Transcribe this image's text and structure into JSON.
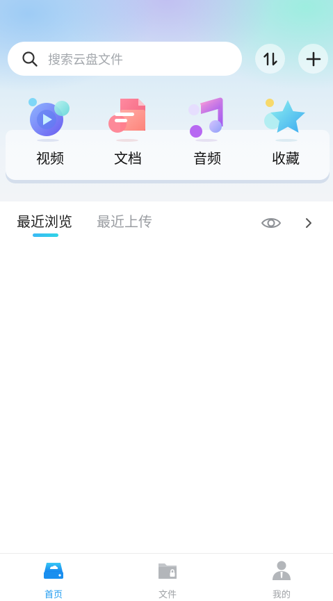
{
  "search": {
    "placeholder": "搜索云盘文件",
    "icon": "search-icon"
  },
  "header_actions": {
    "sort_icon": "sort-transfer-icon",
    "add_icon": "plus-icon"
  },
  "categories": [
    {
      "label": "视频",
      "icon": "video-icon"
    },
    {
      "label": "文档",
      "icon": "document-icon"
    },
    {
      "label": "音频",
      "icon": "music-icon"
    },
    {
      "label": "收藏",
      "icon": "star-icon"
    }
  ],
  "tabs": [
    {
      "label": "最近浏览",
      "active": true
    },
    {
      "label": "最近上传",
      "active": false
    }
  ],
  "bottom_nav": [
    {
      "label": "首页",
      "icon": "cloud-drive-icon",
      "active": true
    },
    {
      "label": "文件",
      "icon": "folder-lock-icon",
      "active": false
    },
    {
      "label": "我的",
      "icon": "user-icon",
      "active": false
    }
  ],
  "colors": {
    "accent": "#1e9bf0",
    "tab_indicator": "#3ab9f5",
    "inactive_text": "#9fa2a6"
  }
}
